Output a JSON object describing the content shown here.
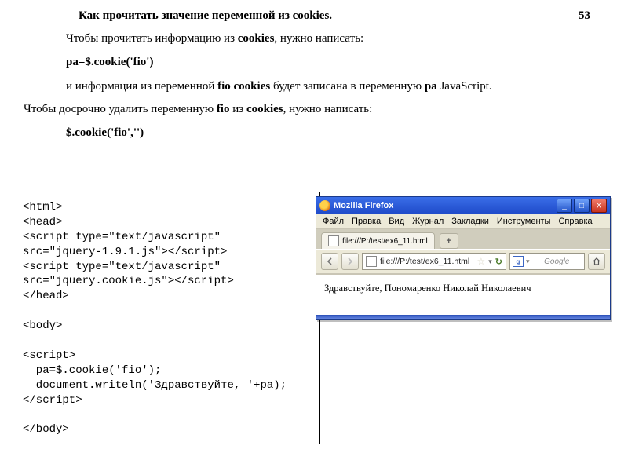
{
  "header": {
    "title": "Как прочитать значение переменной из cookies.",
    "page_number": "53"
  },
  "paragraphs": {
    "p1_pre": "Чтобы  прочитать  информацию  из ",
    "p1_kw": "cookies",
    "p1_post": ", нужно написать:",
    "code1": "pa=$.cookie('fio')",
    "p2_pre": "и информация из переменной ",
    "p2_kw1": "fio cookies",
    "p2_mid": " будет записана в переменную ",
    "p2_kw2": "pa",
    "p2_post": " JavaScript.",
    "p3_pre": "Чтобы  досрочно  удалить  переменную  ",
    "p3_kw1": "fio",
    "p3_mid": "  из  ",
    "p3_kw2": "cookies",
    "p3_post": ", нужно написать:",
    "code2": "$.cookie('fio','')"
  },
  "codebox": {
    "lines": "<html>\n<head>\n<script type=\"text/javascript\"\nsrc=\"jquery-1.9.1.js\"></script>\n<script type=\"text/javascript\"\nsrc=\"jquery.cookie.js\"></script>\n</head>\n\n<body>\n\n<script>\n  pa=$.cookie('fio');\n  document.writeln('Здравствуйте, '+pa);\n</script>\n\n</body>"
  },
  "browser": {
    "title": "Mozilla Firefox",
    "menu": {
      "file": "Файл",
      "edit": "Правка",
      "view": "Вид",
      "journal": "Журнал",
      "bookmarks": "Закладки",
      "tools": "Инструменты",
      "help": "Справка"
    },
    "tab_label": "file:///P:/test/ex6_11.html",
    "newtab_label": "+",
    "url": "file:///P:/test/ex6_11.html",
    "search_placeholder": "Google",
    "page_text": "Здравствуйте, Пономаренко Николай Николаевич",
    "buttons": {
      "min": "_",
      "max": "□",
      "close": "X"
    }
  }
}
